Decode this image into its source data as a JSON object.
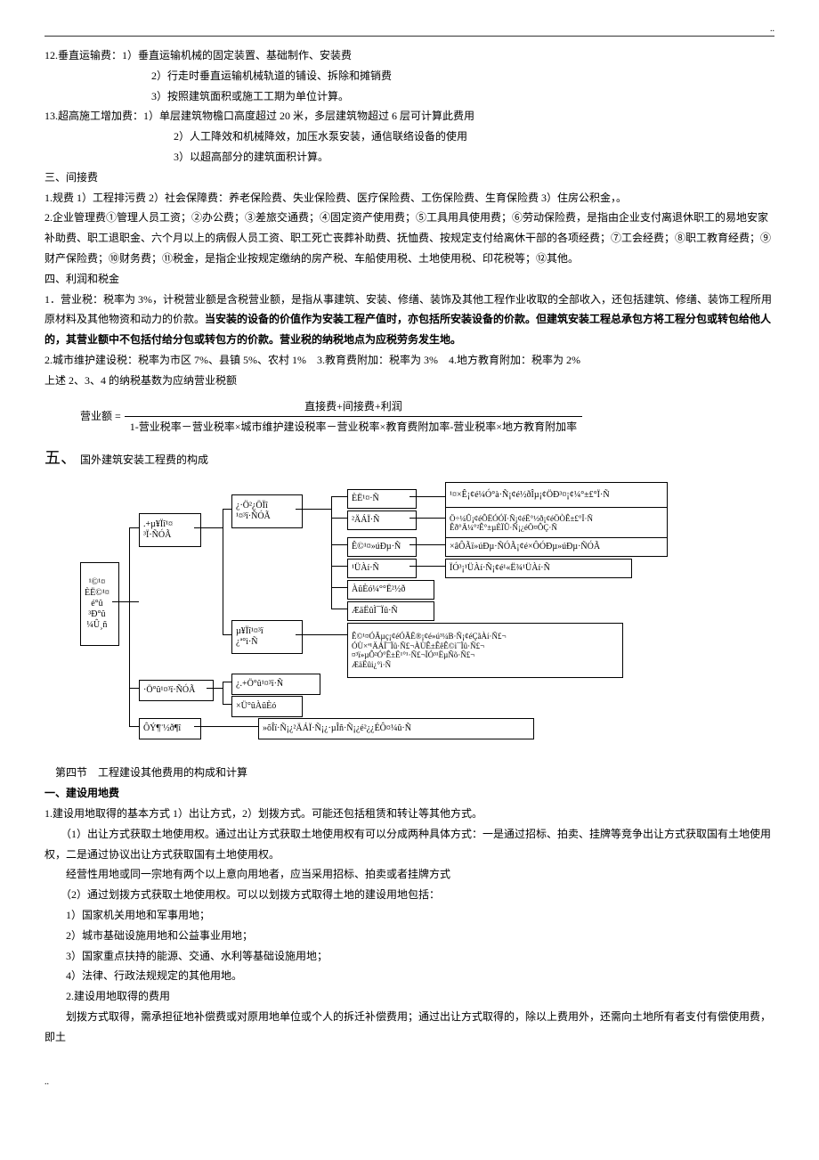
{
  "dots": "..",
  "l1": "12.垂直运输费：1）垂直运输机械的固定装置、基础制作、安装费",
  "l1a": "2）行走时垂直运输机械轨道的铺设、拆除和摊销费",
  "l1b": "3）按照建筑面积或施工工期为单位计算。",
  "l2": "13.超高施工增加费：1）单层建筑物檐口高度超过 20 米，多层建筑物超过 6 层可计算此费用",
  "l2a": "2）人工降效和机械降效，加压水泵安装，通信联络设备的使用",
  "l2b": "3）以超高部分的建筑面积计算。",
  "h3": "三、间接费",
  "l3": "1.规费 1）工程排污费 2）社会保障费：养老保险费、失业保险费、医疗保险费、工伤保险费、生育保险费 3）住房公积金，。",
  "l4": "2.企业管理费①管理人员工资；②办公费；③差旅交通费；④固定资产使用费；⑤工具用具使用费；⑥劳动保险费，是指由企业支付离退休职工的易地安家补助费、职工退职金、六个月以上的病假人员工资、职工死亡丧葬补助费、抚恤费、按规定支付给离休干部的各项经费；⑦工会经费；⑧职工教育经费；⑨财产保险费；⑩财务费；⑪税金，是指企业按规定缴纳的房产税、车船使用税、土地使用税、印花税等；⑫其他。",
  "h4": "四、利润和税金",
  "l5a": "1．营业税：税率为 3%，计税营业额是含税营业额，是指从事建筑、安装、修缮、装饰及其他工程作业收取的全部收入，还包括建筑、修缮、装饰工程所用原材料及其他物资和动力的价款。",
  "l5b": "当安装的设备的价值作为安装工程产值时，亦包括所安装设备的价款。但建筑安装工程总承包方将工程分包或转包给他人的，其营业额中不包括付给分包或转包方的价款。营业税的纳税地点为应税劳务发生地。",
  "l6": "2.城市维护建设税：税率为市区 7%、县镇 5%、农村 1%　3.教育费附加：税率为 3%　4.地方教育附加：税率为 2%",
  "l7": "上述 2、3、4 的纳税基数为应纳营业税额",
  "formula_left": "营业额 =",
  "formula_num": "直接费+间接费+利润",
  "formula_den": "1-营业税率－营业税率×城市维护建设税率－营业税率×教育费附加率-营业税率×地方教育附加率",
  "h5_num": "五、",
  "h5_text": "国外建筑安装工程费的构成",
  "d": {
    "b1": "¹©¹¤\nÈË©¹¤\né°û\n³Ð°û\n¼Û¸ñ",
    "b2": ".+µ¥Ïî¹¤\n³Ï·ÑÓÃ",
    "b3": "·Ö°û¹¤³ï·ÑÓÃ",
    "b4": "¿·Ö²¿ÖÏî\n¹¤³ï·ÑÓÃ",
    "b5": "µ¥Ïî¹¤³ï\n¿ª°ì·Ñ",
    "b6": "¿.+Ö°û¹¤³ï·Ñ",
    "b7": "×Ü°ûÀûÈó",
    "b8": "ÔÝ¶¨½ð¶î",
    "r1": "ÈË¹¤·Ñ",
    "r2": "²ÄÁÏ·Ñ",
    "r3": "Ê©¹¤»úÐµ·Ñ",
    "r4": "¹ÜÀí·Ñ",
    "r5": "ÀûÈó¼°°Ë²½ð",
    "r6": "ÆäËûÌ¯Ïû·Ñ",
    "rr1": "¹¤×Ê¡¢é¼Ó°à·Ñ¡¢é½ðÎµ¡¢ÖÐ³¤¡¢¼°±£°Ï·Ñ",
    "rr2": "Ö÷¼Û¡¢éÔËÓÓÏ·Ñ¡¢éË°½ð¡¢éÖÒÊ±£°Ï·Ñ\nÊð°Ä¼°²Ê°±µÈÏÛ·Ñ¡¿éÖ¤ÔÇ·Ñ",
    "rr3": "×âÔÃï»úÐµ·ÑÓÃ¡¢é×ÔÓÐµ»úÐµ·ÑÓÃ",
    "rr4": "ÏÓ³¡¹ÜÀí·Ñ¡¢é¹«Ë¾¹ÜÀí·Ñ",
    "rr5": "Ê©¹¤ÓÃµç¡¢éÓÃË®¡¢é»ú³¼В·Ñ¡¢éÇãÀí·Ñ£¬\nÓÙ×ª¹ÄÁÏ¯Ïû·Ñ£¬ÀÙÊ±ÊêÊ©ì¯Ïû·Ñ£¬\n¤³ï»µÔ²Ó°Ê±Ë¹°¹·Ñ£¬ÏÓ³¹ËµÑõ·Ñ£¬\nÆäËûi¿°ì·Ñ",
    "rr6": "»õÎï·Ñ¡¿²ÄÁÏ·Ñ¡¿·µÎñ·Ñ¡¿é²¿¿ÉÔ¤¼û·Ñ"
  },
  "s4_title": "　第四节　工程建设其他费用的构成和计算",
  "s4_h1": "一、建设用地费",
  "s4_1": "1.建设用地取得的基本方式 1）出让方式，2）划拨方式。可能还包括租赁和转让等其他方式。",
  "s4_2": "　　（1）出让方式获取土地使用权。通过出让方式获取土地使用权有可以分成两种具体方式：一是通过招标、拍卖、挂牌等竞争出让方式获取国有土地使用权，二是通过协议出让方式获取国有土地使用权。",
  "s4_3": "　　经营性用地或同一宗地有两个以上意向用地者，应当采用招标、拍卖或者挂牌方式",
  "s4_4": "　　（2）通过划拨方式获取土地使用权。可以以划拨方式取得土地的建设用地包括：",
  "s4_5": "　　1）国家机关用地和军事用地；",
  "s4_6": "　　2）城市基础设施用地和公益事业用地；",
  "s4_7": "　　3）国家重点扶持的能源、交通、水利等基础设施用地；",
  "s4_8": "　　4）法律、行政法规规定的其他用地。",
  "s4_9": "　　2.建设用地取得的费用",
  "s4_10": "　　划拨方式取得，需承担征地补偿费或对原用地单位或个人的拆迁补偿费用；通过出让方式取得的，除以上费用外，还需向土地所有者支付有偿使用费，即土",
  "footer": ".."
}
